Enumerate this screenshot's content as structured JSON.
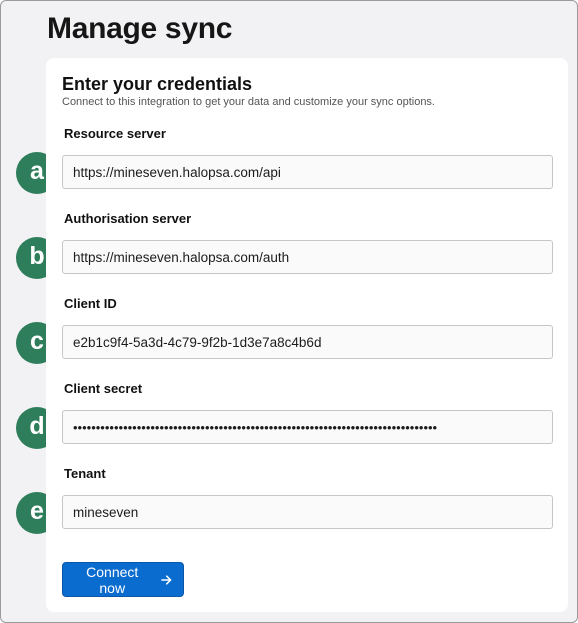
{
  "page": {
    "title": "Manage sync"
  },
  "card": {
    "title": "Enter your credentials",
    "subtitle": "Connect to this integration to get your data and customize your sync options."
  },
  "fields": [
    {
      "marker": "a",
      "label": "Resource server",
      "value": "https://mineseven.halopsa.com/api"
    },
    {
      "marker": "b",
      "label": "Authorisation server",
      "value": "https://mineseven.halopsa.com/auth"
    },
    {
      "marker": "c",
      "label": "Client ID",
      "value": "e2b1c9f4-5a3d-4c79-9f2b-1d3e7a8c4b6d"
    },
    {
      "marker": "d",
      "label": "Client secret",
      "value": "••••••••••••••••••••••••••••••••••••••••••••••••••••••••••••••••••••••••••••••••"
    },
    {
      "marker": "e",
      "label": "Tenant",
      "value": "mineseven"
    }
  ],
  "connect_button": {
    "label": "Connect now",
    "icon": "arrow-right-icon"
  },
  "colors": {
    "accent": "#0b6ccf",
    "marker": "#2e7d5b",
    "background": "#f2f2f4"
  }
}
